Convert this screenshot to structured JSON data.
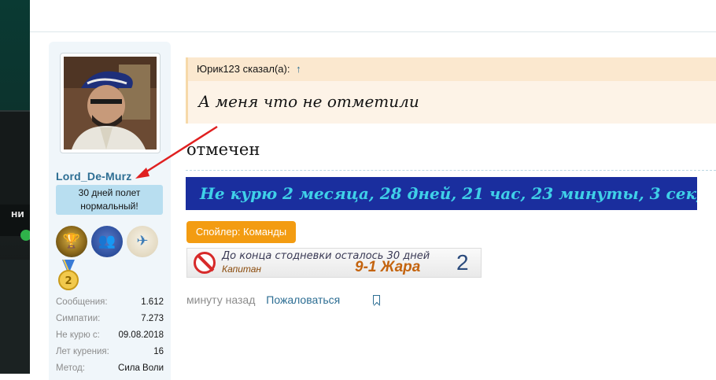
{
  "user": {
    "username": "Lord_De-Murz",
    "title": "30 дней полет нормальный!",
    "trophies": [
      "trophy-cup-icon",
      "community-people-icon",
      "airplane-icon",
      "medal-2-icon"
    ],
    "stats": [
      {
        "key": "Сообщения:",
        "value": "1.612"
      },
      {
        "key": "Симпатии:",
        "value": "7.273"
      },
      {
        "key": "Не курю с:",
        "value": "09.08.2018"
      },
      {
        "key": "Лет курения:",
        "value": "16"
      },
      {
        "key": "Метод:",
        "value": "Сила Воли"
      }
    ]
  },
  "quote": {
    "author": "Юрик123 сказал(а):",
    "arrow": "↑",
    "text": "А меня что не отметили"
  },
  "post": {
    "text": "отмечен"
  },
  "signature": {
    "no_smoking": "Не курю  2 месяца, 28 дней, 21 час, 23 минуты, 3 секунды",
    "spoiler_label": "Спойлер: Команды",
    "counter_line1": "До конца стодневки осталось 30 дней",
    "counter_line2": "Капитан",
    "counter_rank": "9-1 Жара",
    "counter_num": "2"
  },
  "meta": {
    "time": "минуту назад",
    "report": "Пожаловаться"
  },
  "colors": {
    "accent": "#2d6e93",
    "spoiler": "#f39c12",
    "banner_bg": "#1a2e9e",
    "banner_text": "#3fd0e8",
    "annotation_arrow": "#e02020"
  }
}
